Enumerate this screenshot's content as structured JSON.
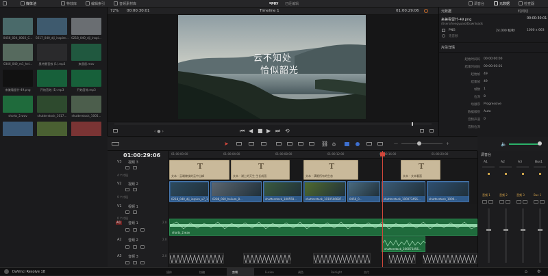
{
  "topbar": {
    "media_pool": "媒体池",
    "effects": "特效库",
    "edit_index": "编辑索引",
    "sound_library": "音频素材库",
    "project_name": "spgy",
    "project_status": "已经编辑",
    "mixer": "调音台",
    "metadata": "元数据",
    "inspector": "检查器"
  },
  "media_pool": {
    "items": [
      {
        "label": "0456_024_0002_C...",
        "color": "#4a6a6a"
      },
      {
        "label": "0217_040_dji_inspire...",
        "color": "#3e5a6e"
      },
      {
        "label": "0218_040_dji_inspi...",
        "color": "#6a6e72"
      },
      {
        "label": "0346_040_m1_hel...",
        "color": "#566a5e"
      },
      {
        "label": "奥特曼音效 (1).mp3",
        "color": "#2a2a2c"
      },
      {
        "label": "来遥遥.mov",
        "color": "#20583f"
      },
      {
        "label": "来兼看留什-49.png",
        "color": "#111"
      },
      {
        "label": "开始音效 (1).mp3",
        "color": "#17603a"
      },
      {
        "label": "开始音效.mp3",
        "color": "#17603a"
      },
      {
        "label": "shorts_2.wav",
        "color": "#1f6b3c"
      },
      {
        "label": "shutterstock_1017...",
        "color": "#2e4a2e"
      },
      {
        "label": "shutterstock_1005...",
        "color": "#4c5e4c"
      },
      {
        "label": "shutterstock_1005...",
        "color": "#3a5876"
      },
      {
        "label": "shutterstock_1005...",
        "color": "#4a6032"
      },
      {
        "label": "Timeline 1",
        "color": "#7a3434"
      }
    ]
  },
  "viewer": {
    "zoom": "72%",
    "source_tc": "00:00:30:01",
    "timeline_name": "Timeline 1",
    "record_tc": "01:00:29:06",
    "video_caption_line1": "云不知处",
    "video_caption_line2": "恰似韶光"
  },
  "inspector": {
    "header": "元数据",
    "header_right": "时间线",
    "file_name": "来兼看留什-49.png",
    "file_tc": "00:00:30:01",
    "file_path": "/Users/hengyuaio/Downloads",
    "format": "PNG",
    "fps": "24.000 帧/秒",
    "resolution": "1000 x 663",
    "no_audio": "无音频",
    "section": "片段详情",
    "rows": [
      {
        "k": "起始时间码",
        "v": "00:00:00:00"
      },
      {
        "k": "结束时间码",
        "v": "00:00:00:01"
      },
      {
        "k": "起始帧",
        "v": "49"
      },
      {
        "k": "结束帧",
        "v": "49"
      },
      {
        "k": "帧数",
        "v": "1"
      },
      {
        "k": "位深",
        "v": "8"
      },
      {
        "k": "场顺序",
        "v": "Progressive"
      },
      {
        "k": "数据级别",
        "v": "Auto"
      },
      {
        "k": "音频声道",
        "v": "0"
      },
      {
        "k": "音频位深",
        "v": ""
      }
    ]
  },
  "timeline": {
    "timecode": "01:00:29:06",
    "ruler": [
      "01:00:00:00",
      "01:00:04:00",
      "01:00:08:00",
      "01:00:12:00",
      "01:00:16:00",
      "01:00:20:00"
    ],
    "tracks": {
      "v3": {
        "id": "V3",
        "name": "视频 3",
        "count": "4 个片段"
      },
      "v2": {
        "id": "V2",
        "name": "视频 2",
        "count": "9 个片段"
      },
      "v1": {
        "id": "V1",
        "name": "视频 1",
        "count": "0 个片段"
      },
      "a1": {
        "id": "A1",
        "name": "音频 1",
        "value": "2.0"
      },
      "a2": {
        "id": "A2",
        "name": "音频 2",
        "value": "2.0"
      },
      "a3": {
        "id": "A3",
        "name": "音频 3",
        "value": "2.0"
      }
    },
    "title_clips": [
      {
        "label": "文本 - 云端缭绕的云中山峰"
      },
      {
        "label": "文本 - 湖上的天生 生长成画"
      },
      {
        "label": "文本 - 满眼所有的生态"
      },
      {
        "label": "文本 - 文本看面"
      }
    ],
    "video_clips": [
      {
        "label": "0218_040_dji_inspire_x7_1..."
      },
      {
        "label": "0288_060_helium_8..."
      },
      {
        "label": "shutterstock_100559..."
      },
      {
        "label": "shutterstock_1010506687..."
      },
      {
        "label": "0456_0..."
      },
      {
        "label": "shutterstock_100073456..."
      },
      {
        "label": "shutterstock_1009..."
      }
    ],
    "audio_clips": {
      "a1": "shorts_2.wav",
      "a2": "shutterstock_100073456..."
    }
  },
  "mixer": {
    "title": "调音台",
    "channels": [
      "A1",
      "A2",
      "A3",
      "Bus1"
    ],
    "names": [
      "音频 1",
      "音频 2",
      "音频 3",
      "Bus 1"
    ]
  },
  "bottom": {
    "app_name": "DaVinci Resolve 18",
    "pages": [
      "媒体",
      "快编",
      "剪辑",
      "Fusion",
      "调色",
      "Fairlight",
      "交付"
    ]
  }
}
